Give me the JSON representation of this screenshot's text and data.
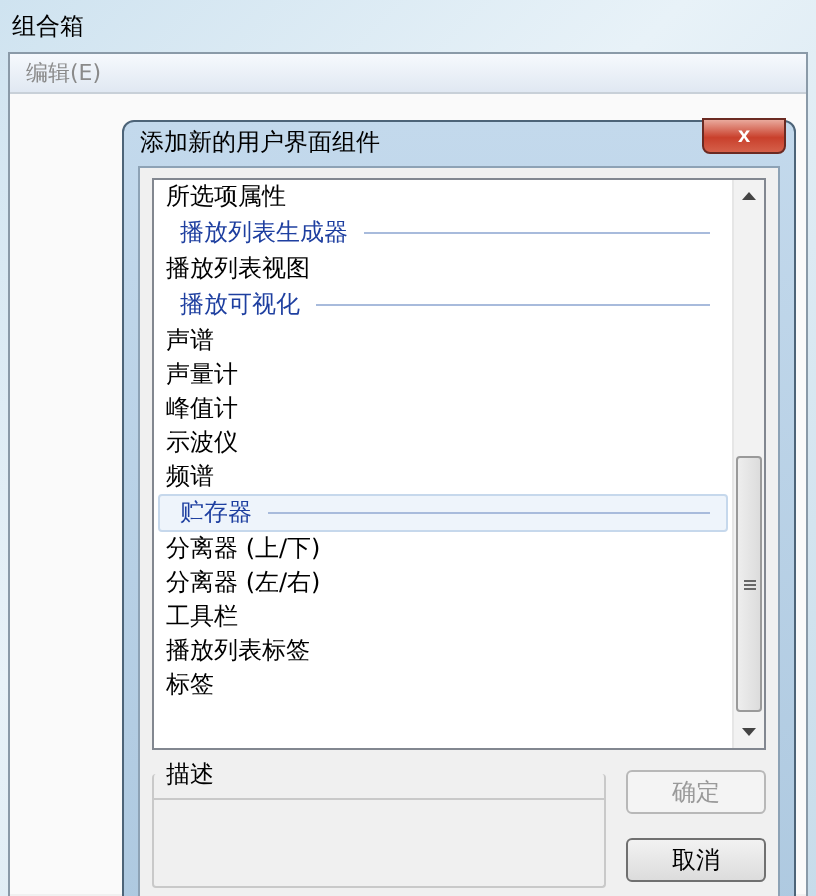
{
  "window": {
    "title": "组合箱"
  },
  "menu": [
    {
      "label": "编辑(E)",
      "disabled": true
    }
  ],
  "dialog": {
    "title": "添加新的用户界面组件",
    "close": "x",
    "items": [
      {
        "kind": "item",
        "label": "所选项属性",
        "selected": false
      },
      {
        "kind": "header",
        "label": "播放列表生成器",
        "selected": false
      },
      {
        "kind": "item",
        "label": "播放列表视图",
        "selected": false
      },
      {
        "kind": "header",
        "label": "播放可视化",
        "selected": false
      },
      {
        "kind": "item",
        "label": "声谱",
        "selected": false
      },
      {
        "kind": "item",
        "label": "声量计",
        "selected": false
      },
      {
        "kind": "item",
        "label": "峰值计",
        "selected": false
      },
      {
        "kind": "item",
        "label": "示波仪",
        "selected": false
      },
      {
        "kind": "item",
        "label": "频谱",
        "selected": false
      },
      {
        "kind": "header",
        "label": "贮存器",
        "selected": true
      },
      {
        "kind": "item",
        "label": "分离器 (上/下)",
        "selected": false
      },
      {
        "kind": "item",
        "label": "分离器 (左/右)",
        "selected": false
      },
      {
        "kind": "item",
        "label": "工具栏",
        "selected": false
      },
      {
        "kind": "item",
        "label": "播放列表标签",
        "selected": false
      },
      {
        "kind": "item",
        "label": "标签",
        "selected": false
      }
    ],
    "description": {
      "label": "描述"
    },
    "buttons": [
      {
        "label": "确定",
        "disabled": true
      },
      {
        "label": "取消",
        "disabled": false
      }
    ]
  }
}
